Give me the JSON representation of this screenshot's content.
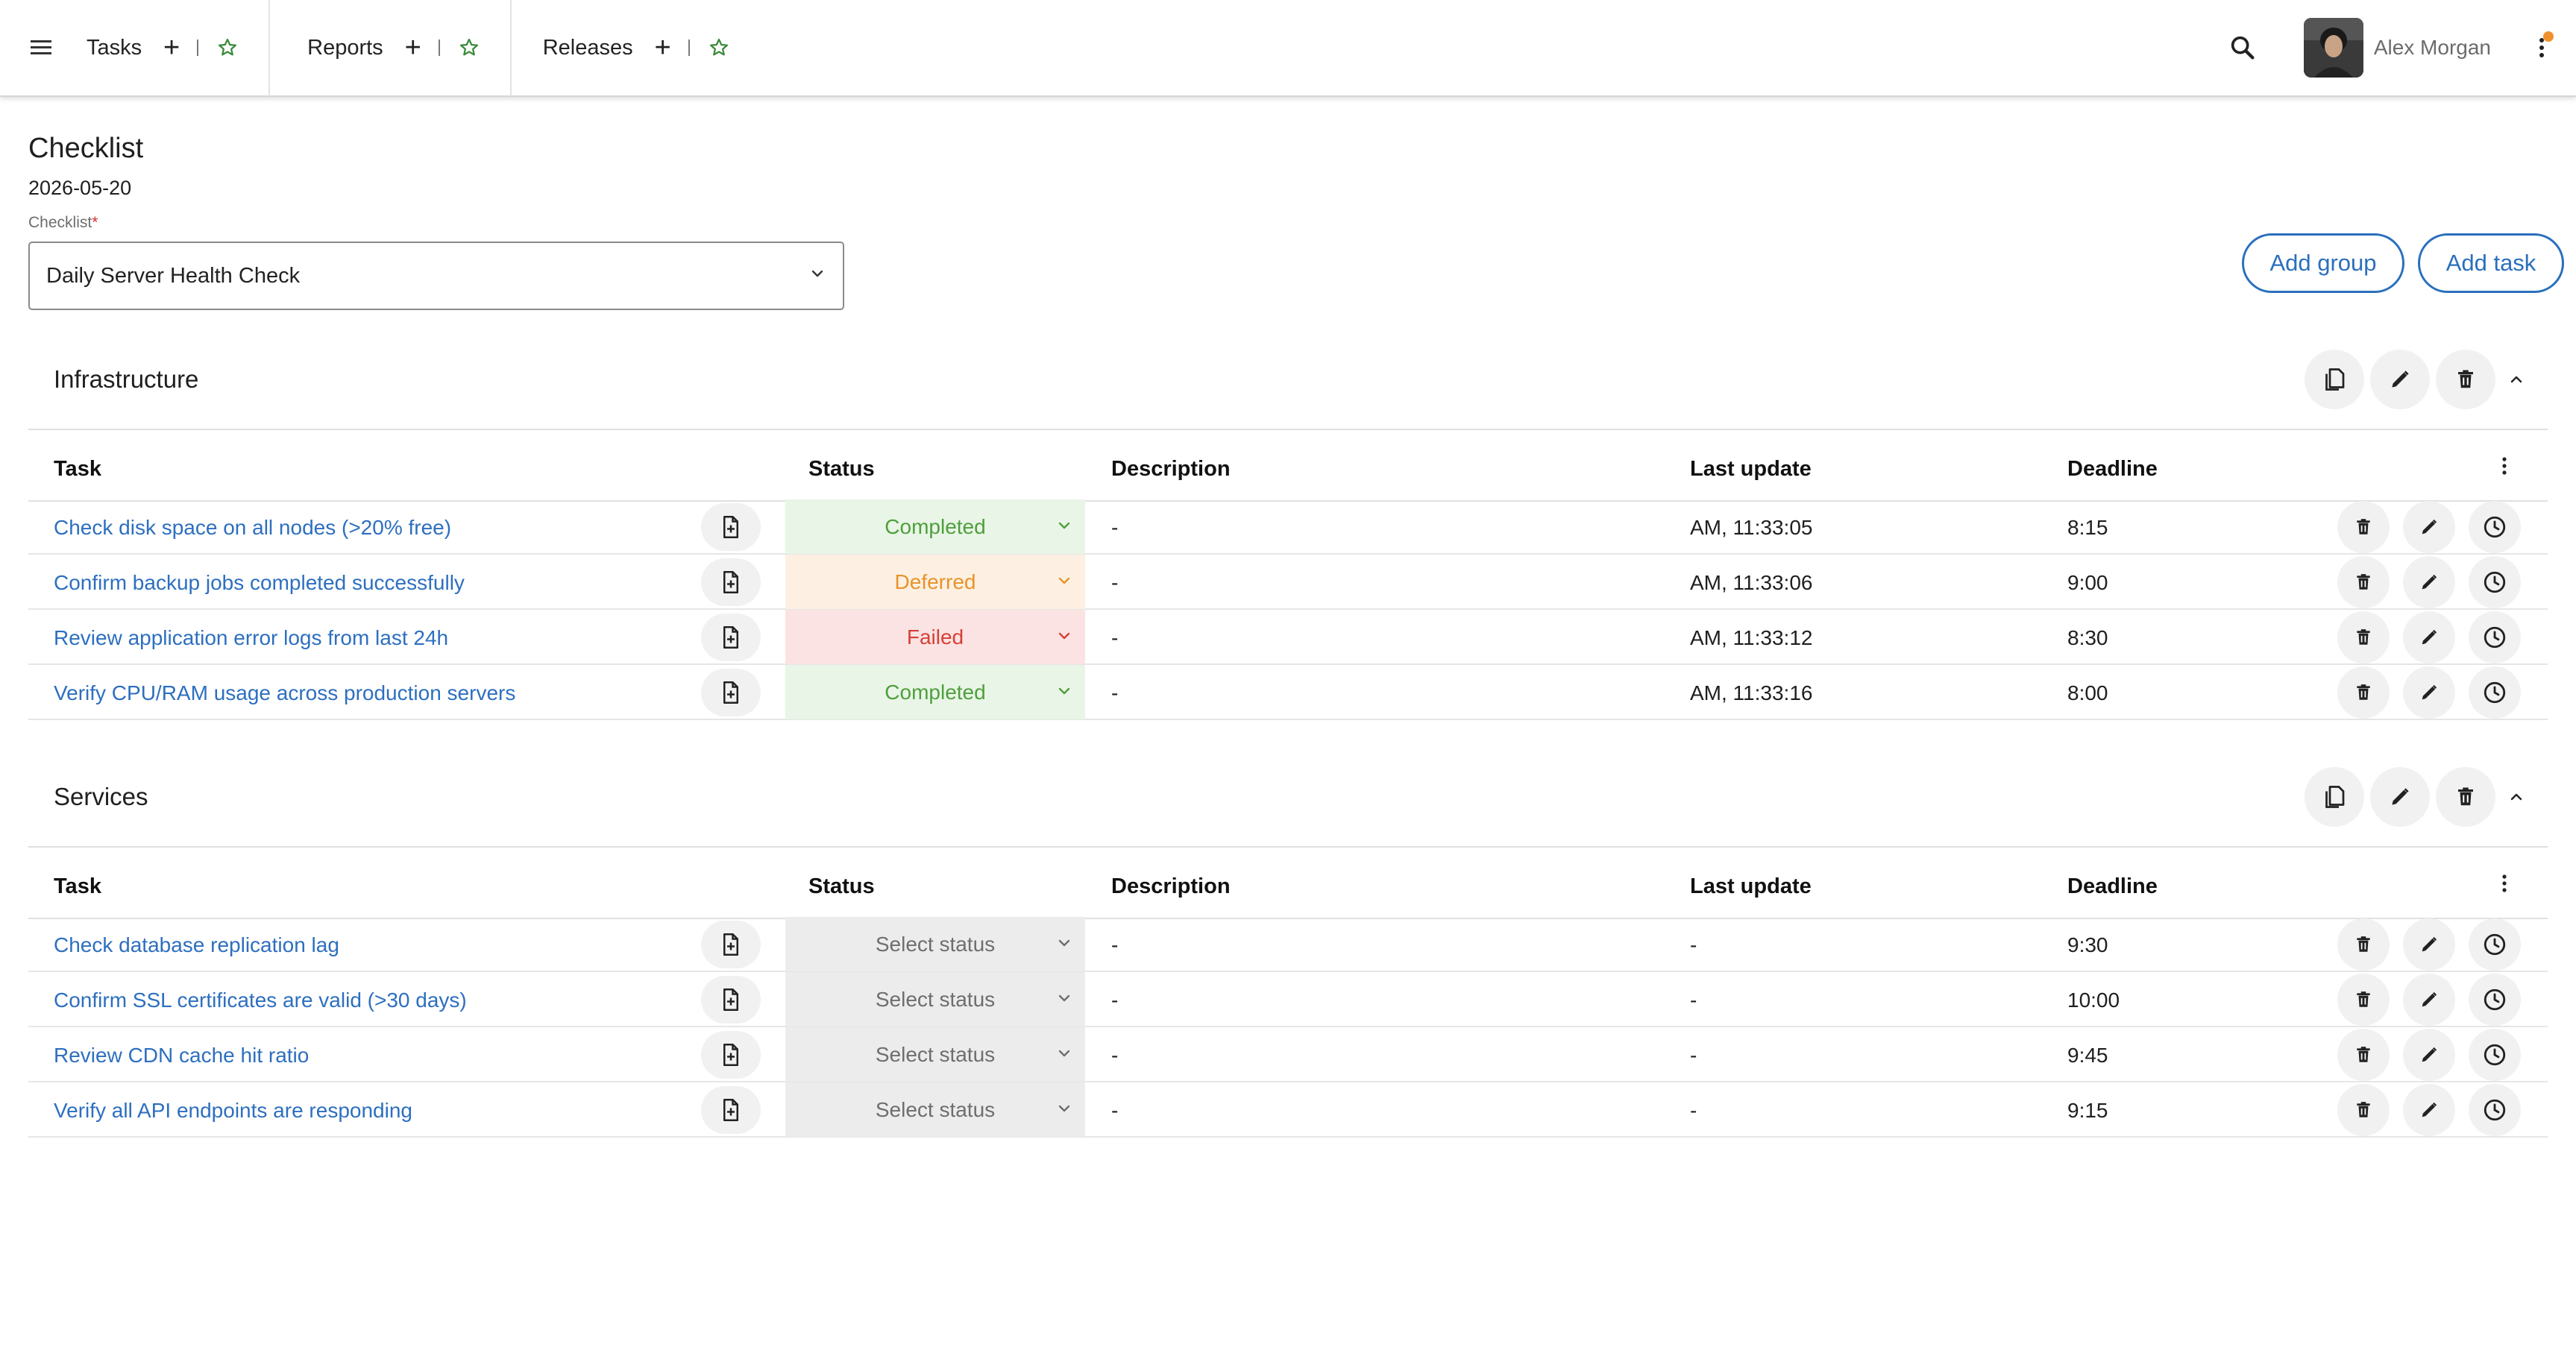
{
  "nav": {
    "tabs": [
      {
        "label": "Tasks"
      },
      {
        "label": "Reports"
      },
      {
        "label": "Releases"
      }
    ],
    "plus": "+",
    "user_name": "Alex Morgan"
  },
  "header": {
    "title": "Checklist",
    "date": "2026-05-20",
    "field_label": "Checklist",
    "required_mark": "*",
    "selected_checklist": "Daily Server Health Check",
    "add_group_label": "Add group",
    "add_task_label": "Add task"
  },
  "columns": {
    "task": "Task",
    "status": "Status",
    "description": "Description",
    "last_update": "Last update",
    "deadline": "Deadline"
  },
  "groups": [
    {
      "name": "Infrastructure",
      "rows": [
        {
          "task": "Check disk space on all nodes (>20% free)",
          "status": "Completed",
          "description": "-",
          "last_update": "AM, 11:33:05",
          "deadline": "8:15"
        },
        {
          "task": "Confirm backup jobs completed successfully",
          "status": "Deferred",
          "description": "-",
          "last_update": "AM, 11:33:06",
          "deadline": "9:00"
        },
        {
          "task": "Review application error logs from last 24h",
          "status": "Failed",
          "description": "-",
          "last_update": "AM, 11:33:12",
          "deadline": "8:30"
        },
        {
          "task": "Verify CPU/RAM usage across production servers",
          "status": "Completed",
          "description": "-",
          "last_update": "AM, 11:33:16",
          "deadline": "8:00"
        }
      ]
    },
    {
      "name": "Services",
      "rows": [
        {
          "task": "Check database replication lag",
          "status": "Select status",
          "description": "-",
          "last_update": "-",
          "deadline": "9:30"
        },
        {
          "task": "Confirm SSL certificates are valid (>30 days)",
          "status": "Select status",
          "description": "-",
          "last_update": "-",
          "deadline": "10:00"
        },
        {
          "task": "Review CDN cache hit ratio",
          "status": "Select status",
          "description": "-",
          "last_update": "-",
          "deadline": "9:45"
        },
        {
          "task": "Verify all API endpoints are responding",
          "status": "Select status",
          "description": "-",
          "last_update": "-",
          "deadline": "9:15"
        }
      ]
    }
  ],
  "colors": {
    "link": "#2d6fbf",
    "accent": "#2a6fbd",
    "completed": "#4e9f3d",
    "deferred": "#e8932a",
    "failed": "#d64035",
    "star": "#3a8a3a",
    "notification": "#f0922b"
  }
}
